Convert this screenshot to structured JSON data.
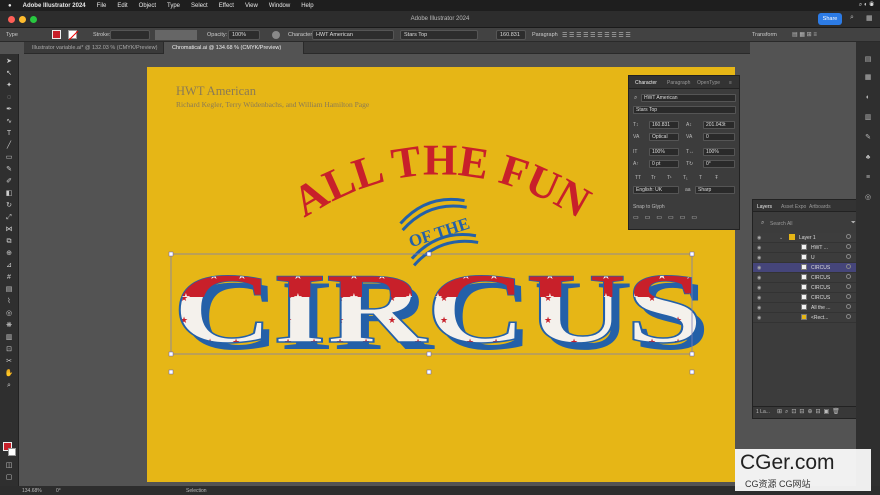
{
  "menubar": {
    "apple": "",
    "app": "Adobe Illustrator 2024",
    "items": [
      "File",
      "Edit",
      "Object",
      "Type",
      "Select",
      "Effect",
      "View",
      "Window",
      "Help"
    ]
  },
  "window": {
    "title": "Adobe Illustrator 2024",
    "share": "Share"
  },
  "control": {
    "type_label": "Type",
    "stroke_label": "Stroke:",
    "opacity_label": "Opacity:",
    "opacity_value": "100%",
    "character_label": "Character",
    "font": "HWT American",
    "style": "Stars Top",
    "size": "160.831",
    "paragraph_label": "Paragraph",
    "transform_label": "Transform"
  },
  "doctabs": [
    "Illustrator variable.ai* @ 132.03 % (CMYK/Preview)",
    "Chromatical.ai @ 134.68 % (CMYK/Preview)"
  ],
  "artboard": {
    "title": "HWT American",
    "authors": "Richard Kegler, Terry Wüdenbachs, and William Hamilton Page",
    "arc_text": "ALL THE FUN",
    "of_the": "OF THE",
    "circus": "CIRCUS",
    "colors": {
      "bg": "#e6b616",
      "red": "#c8202a",
      "blue": "#2460a8",
      "white": "#f4f1ec"
    }
  },
  "character_panel": {
    "tabs": [
      "Character",
      "Paragraph",
      "OpenType"
    ],
    "font": "HWT American",
    "style": "Stars Top",
    "size": "160.831",
    "leading": "201.043t",
    "kerning": "Optical",
    "tracking": "0",
    "vscale": "100%",
    "hscale": "100%",
    "baseline": "0 pt",
    "rotation": "0°",
    "language": "English: UK",
    "antialias": "Sharp",
    "snap": "Snap to Glyph",
    "caps": [
      "TT",
      "Tr",
      "T¹",
      "T₁",
      "T",
      "Ŧ"
    ]
  },
  "layers_panel": {
    "tabs": [
      "Layers",
      "Asset Expo",
      "Artboards"
    ],
    "search_placeholder": "Search All",
    "layer": "Layer 1",
    "rows": [
      "HWT ...",
      "U",
      "CIRCUS",
      "CIRCUS",
      "CIRCUS",
      "CIRCUS",
      "All the ...",
      "<Rect..."
    ],
    "footer": "1 La..."
  },
  "status": {
    "zoom": "134.68%",
    "rotate": "0°",
    "tool": "Selection"
  },
  "watermark": {
    "brand": "CGer.com",
    "sub": "CG资源  CG网站"
  }
}
